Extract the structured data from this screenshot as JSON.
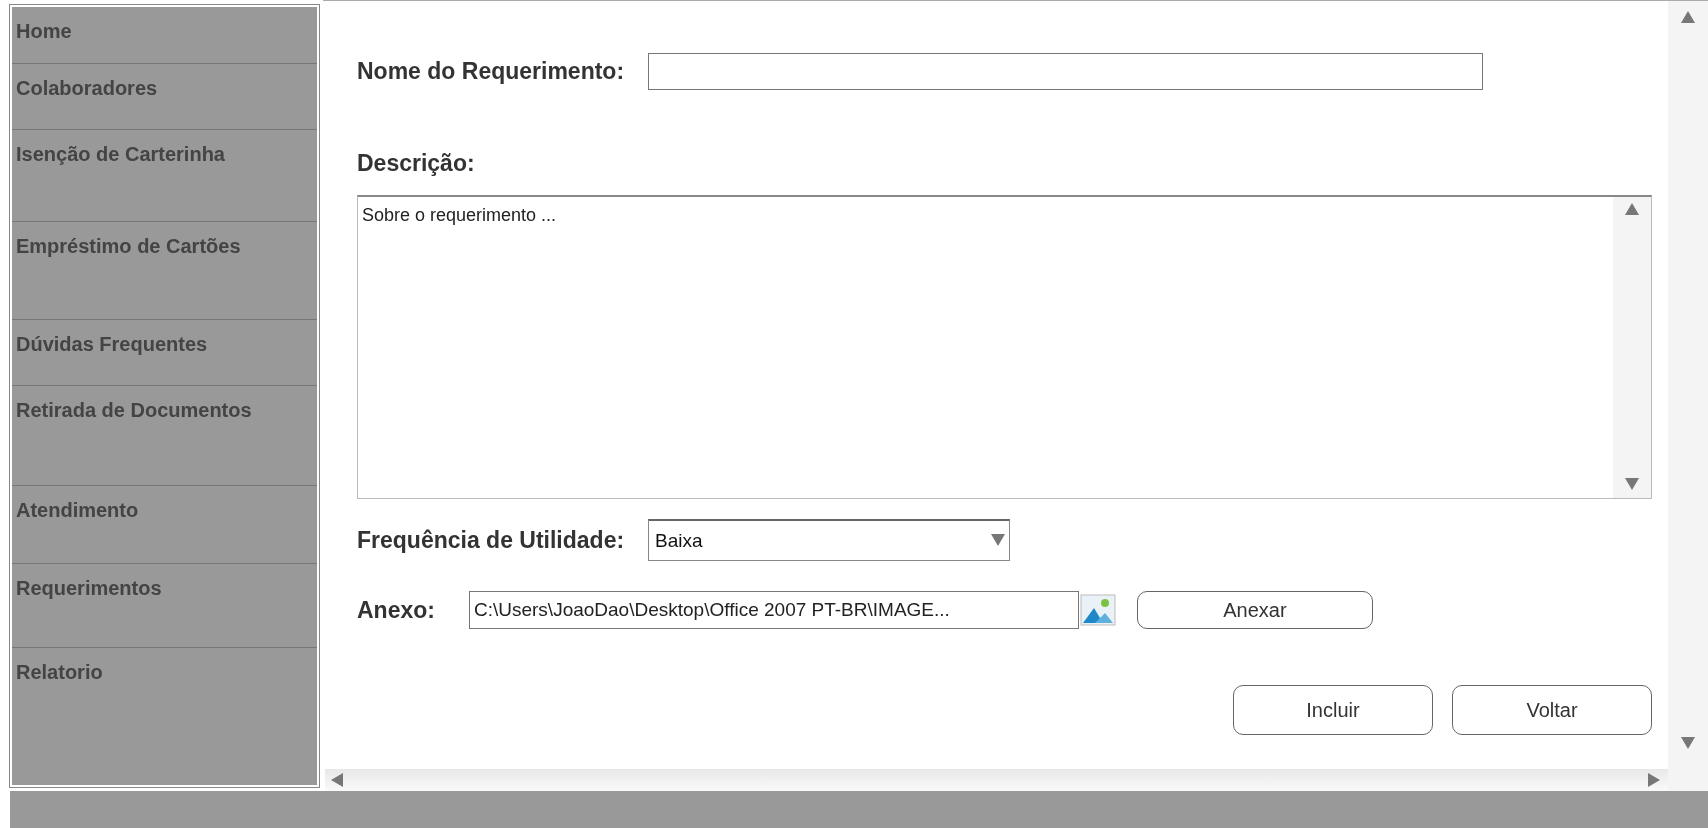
{
  "sidebar": {
    "items": [
      {
        "label": "Home"
      },
      {
        "label": "Colaboradores"
      },
      {
        "label": "Isenção de Carterinha"
      },
      {
        "label": "Empréstimo de Cartões"
      },
      {
        "label": "Dúvidas Frequentes"
      },
      {
        "label": "Retirada de Documentos"
      },
      {
        "label": "Atendimento"
      },
      {
        "label": "Requerimentos"
      },
      {
        "label": "Relatorio"
      }
    ]
  },
  "form": {
    "name": {
      "label": "Nome do Requerimento:"
    },
    "description": {
      "label": "Descrição:",
      "value": "Sobre o requerimento ..."
    },
    "frequency": {
      "label": "Frequência de Utilidade:",
      "value": "Baixa"
    },
    "attachment": {
      "label": "Anexo:",
      "value": "C:\\Users\\JoaoDao\\Desktop\\Office 2007 PT-BR\\IMAGE...",
      "button": "Anexar"
    },
    "buttons": [
      "Incluir",
      "Voltar"
    ]
  }
}
